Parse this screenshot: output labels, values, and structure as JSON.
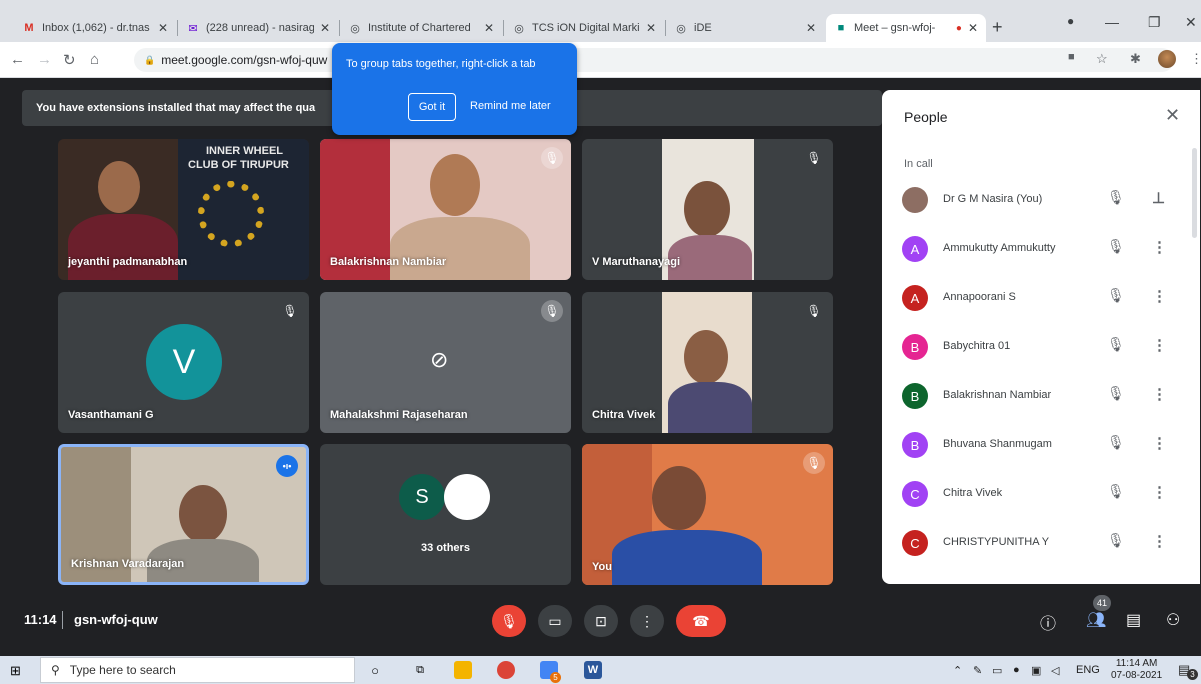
{
  "browser": {
    "tabs": [
      {
        "label": "Inbox (1,062) - dr.tnas",
        "icon": "gmail-icon"
      },
      {
        "label": "(228 unread) - nasirag",
        "icon": "mail-icon"
      },
      {
        "label": "Institute of Chartered",
        "icon": "globe-icon"
      },
      {
        "label": "TCS iON Digital Markin",
        "icon": "globe-icon"
      },
      {
        "label": "iDE",
        "icon": "globe-icon"
      },
      {
        "label": "Meet – gsn-wfoj-",
        "icon": "meet-icon"
      }
    ],
    "url": "meet.google.com/gsn-wfoj-quw"
  },
  "tooltip": {
    "text": "To group tabs together, right-click a tab",
    "got_it": "Got it",
    "remind": "Remind me later"
  },
  "banner": {
    "text": "You have extensions installed that may affect the qua"
  },
  "tiles": [
    {
      "name": "jeyanthi padmanabhan",
      "muted": false
    },
    {
      "name": "Balakrishnan Nambiar",
      "muted": true
    },
    {
      "name": "V Maruthanayagi",
      "muted": true
    },
    {
      "name": "Vasanthamani G",
      "muted": true,
      "initial": "V"
    },
    {
      "name": "Mahalakshmi Rajaseharan",
      "muted": true
    },
    {
      "name": "Chitra Vivek",
      "muted": true
    },
    {
      "name": "Krishnan Varadarajan",
      "speaking": true
    },
    {
      "name": "33 others",
      "initial": "S"
    },
    {
      "name": "You",
      "muted": true
    }
  ],
  "banner_texts": {
    "club_line1": "INNER WHEEL",
    "club_line2": "CLUB OF TIRUPUR"
  },
  "people": {
    "title": "People",
    "section": "In call",
    "rows": [
      {
        "name": "Dr G M Nasira (You)",
        "initial": "",
        "color": "#8d6e63",
        "action": "pin"
      },
      {
        "name": "Ammukutty Ammukutty",
        "initial": "A",
        "color": "#a142f4",
        "action": "more"
      },
      {
        "name": "Annapoorani S",
        "initial": "A",
        "color": "#c5221f",
        "action": "more"
      },
      {
        "name": "Babychitra 01",
        "initial": "B",
        "color": "#e52592",
        "action": "more"
      },
      {
        "name": "Balakrishnan Nambiar",
        "initial": "B",
        "color": "#0d652d",
        "action": "more"
      },
      {
        "name": "Bhuvana Shanmugam",
        "initial": "B",
        "color": "#a142f4",
        "action": "more"
      },
      {
        "name": "Chitra Vivek",
        "initial": "C",
        "color": "#a142f4",
        "action": "more"
      },
      {
        "name": "CHRISTYPUNITHA Y",
        "initial": "C",
        "color": "#c5221f",
        "action": "more"
      }
    ]
  },
  "callbar": {
    "time": "11:14",
    "code": "gsn-wfoj-quw",
    "participants_count": "41"
  },
  "taskbar": {
    "search_placeholder": "Type here to search",
    "lang": "ENG",
    "time": "11:14 AM",
    "date": "07-08-2021",
    "chrome_badge": "5",
    "notif_badge": "3"
  }
}
